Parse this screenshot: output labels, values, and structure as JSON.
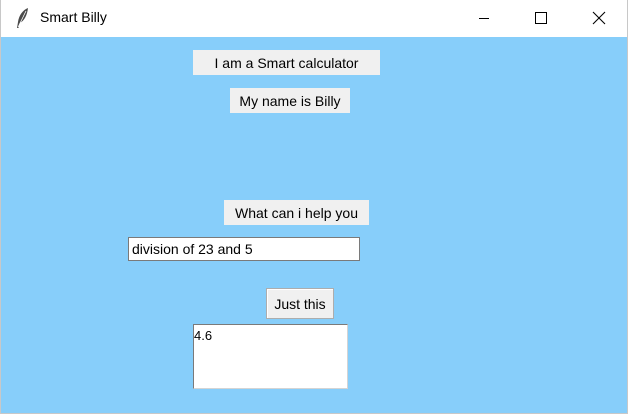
{
  "window": {
    "title": "Smart Billy",
    "icon": "feather-icon",
    "controls": [
      "minimize-icon",
      "maximize-icon",
      "close-icon"
    ],
    "background": "#87cefa"
  },
  "labels": {
    "intro": "I am a Smart calculator",
    "name": "My name is Billy",
    "prompt": "What can i help you"
  },
  "query": {
    "value": "division of 23 and 5"
  },
  "action": {
    "button_label": "Just this"
  },
  "result": {
    "text": "4.6"
  }
}
